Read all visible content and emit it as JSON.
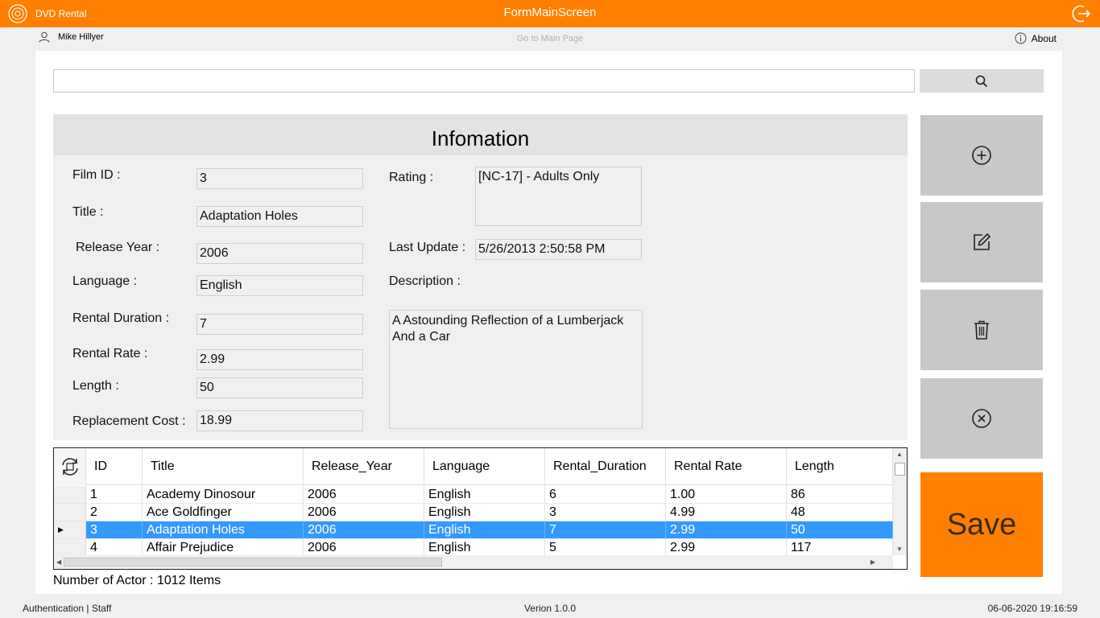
{
  "titlebar": {
    "app_name": "DVD Rental",
    "form_title": "FormMainScreen",
    "exit_icon": "exit-icon",
    "accent_color": "#ff8000"
  },
  "userbar": {
    "user_name": "Mike Hillyer",
    "goto_main": "Go to Main Page",
    "about": "About"
  },
  "search": {
    "value": "",
    "placeholder": ""
  },
  "info": {
    "header": "Infomation",
    "labels": {
      "film_id": "Film ID :",
      "title": "Title :",
      "release_year": "Release Year :",
      "language": "Language :",
      "rental_duration": "Rental Duration :",
      "rental_rate": "Rental Rate :",
      "length": "Length :",
      "replacement_cost": "Replacement Cost :",
      "rating": "Rating :",
      "last_update": "Last Update :",
      "description": "Description :"
    },
    "values": {
      "film_id": "3",
      "title": "Adaptation Holes",
      "release_year": "2006",
      "language": "English",
      "rental_duration": "7",
      "rental_rate": "2.99",
      "length": "50",
      "replacement_cost": "18.99",
      "rating": "[NC-17] - Adults Only",
      "last_update": "5/26/2013 2:50:58 PM",
      "description": "A Astounding Reflection of a Lumberjack And a Car"
    }
  },
  "actions": {
    "add": "add-icon",
    "edit": "edit-icon",
    "delete": "delete-icon",
    "cancel": "cancel-icon",
    "save": "Save"
  },
  "grid": {
    "columns": [
      "ID",
      "Title",
      "Release_Year",
      "Language",
      "Rental_Duration",
      "Rental Rate",
      "Length"
    ],
    "rows": [
      [
        "1",
        "Academy Dinosour",
        "2006",
        "English",
        "6",
        "1.00",
        "86"
      ],
      [
        "2",
        "Ace Goldfinger",
        "2006",
        "English",
        "3",
        "4.99",
        "48"
      ],
      [
        "3",
        "Adaptation Holes",
        "2006",
        "English",
        "7",
        "2.99",
        "50"
      ],
      [
        "4",
        "Affair Prejudice",
        "2006",
        "English",
        "5",
        "2.99",
        "117"
      ]
    ],
    "selected_index": 2,
    "selection_color": "#3399ff"
  },
  "count_label": "Number of Actor : 1012 Items",
  "statusbar": {
    "auth": "Authentication |  Staff",
    "version": "Verion 1.0.0",
    "datetime": "06-06-2020 19:16:59"
  }
}
